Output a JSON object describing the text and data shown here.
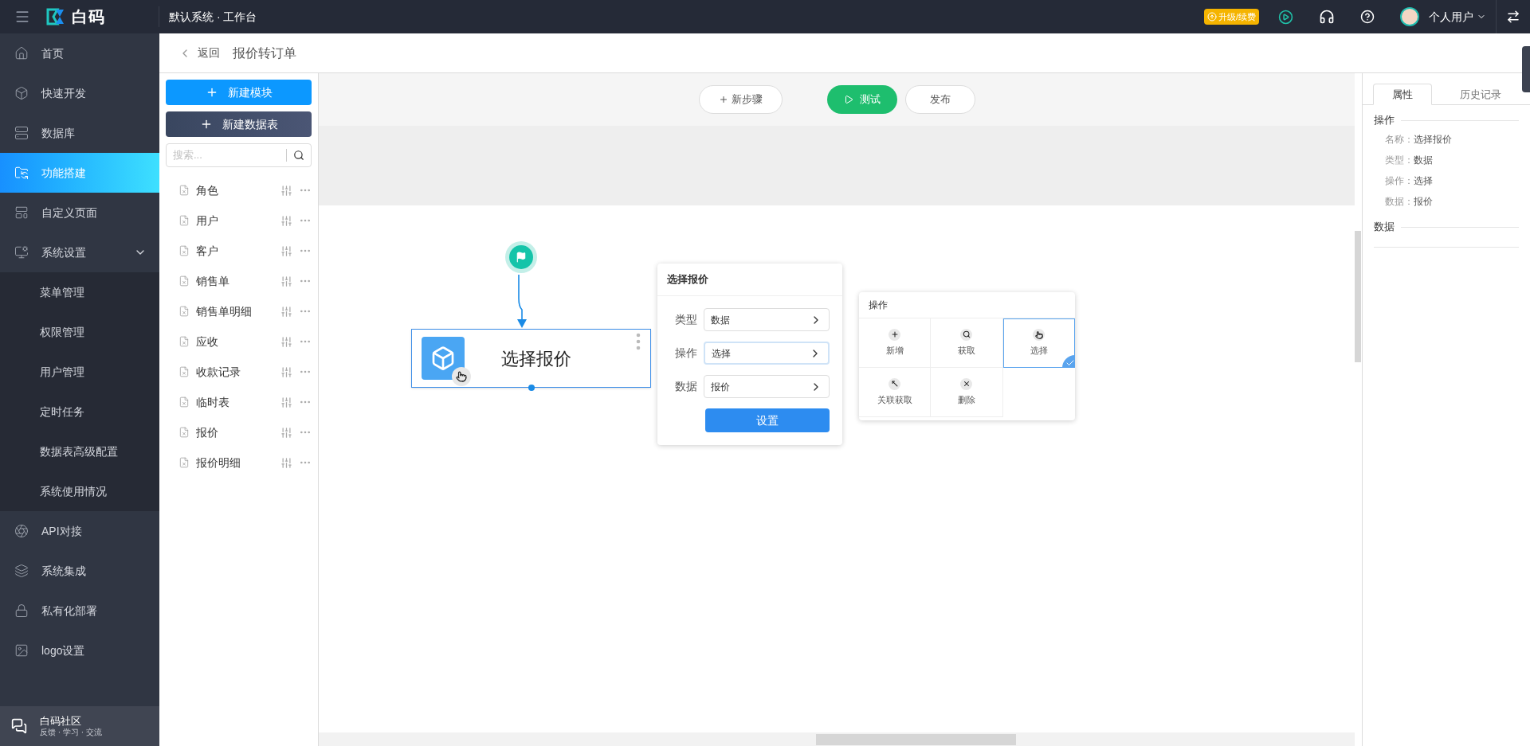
{
  "topbar": {
    "logo_text": "白码",
    "workspace": "默认系统 · 工作台",
    "upgrade": "升级/续费",
    "user": "个人用户"
  },
  "sidebar": {
    "items": [
      {
        "label": "首页",
        "selected": false
      },
      {
        "label": "快速开发",
        "selected": false
      },
      {
        "label": "数据库",
        "selected": false
      },
      {
        "label": "功能搭建",
        "selected": true
      },
      {
        "label": "自定义页面",
        "selected": false
      },
      {
        "label": "系统设置",
        "selected": false,
        "expanded": true,
        "children": [
          {
            "label": "菜单管理"
          },
          {
            "label": "权限管理"
          },
          {
            "label": "用户管理"
          },
          {
            "label": "定时任务"
          },
          {
            "label": "数据表高级配置"
          },
          {
            "label": "系统使用情况"
          }
        ]
      },
      {
        "label": "API对接",
        "selected": false
      },
      {
        "label": "系统集成",
        "selected": false
      },
      {
        "label": "私有化部署",
        "selected": false
      },
      {
        "label": "logo设置",
        "selected": false
      }
    ],
    "community": {
      "title": "白码社区",
      "subtitle": "反馈 · 学习 · 交流"
    }
  },
  "header": {
    "back": "返回",
    "title": "报价转订单"
  },
  "modules": {
    "buttons": [
      {
        "label": "新建模块",
        "kind": "primary"
      },
      {
        "label": "新建数据表",
        "kind": "dark"
      }
    ],
    "search": {
      "placeholder": "搜索..."
    },
    "tables": [
      {
        "name": "角色"
      },
      {
        "name": "用户"
      },
      {
        "name": "客户"
      },
      {
        "name": "销售单"
      },
      {
        "name": "销售单明细"
      },
      {
        "name": "应收"
      },
      {
        "name": "收款记录"
      },
      {
        "name": "临时表"
      },
      {
        "name": "报价"
      },
      {
        "name": "报价明细"
      }
    ]
  },
  "toolbar": {
    "new_step": "新步骤",
    "test": "测试",
    "publish": "发布"
  },
  "canvas": {
    "node": {
      "title": "选择报价",
      "selected": true
    },
    "config": {
      "title": "选择报价",
      "fields": [
        {
          "label": "类型",
          "value": "数据",
          "focused": false
        },
        {
          "label": "操作",
          "value": "选择",
          "focused": true
        },
        {
          "label": "数据",
          "value": "报价",
          "focused": false
        }
      ],
      "button": "设置"
    },
    "operations": {
      "title": "操作",
      "options": [
        {
          "label": "新增",
          "selected": false
        },
        {
          "label": "获取",
          "selected": false
        },
        {
          "label": "选择",
          "selected": true
        },
        {
          "label": "关联获取",
          "selected": false
        },
        {
          "label": "删除",
          "selected": false
        }
      ]
    }
  },
  "properties": {
    "tabs": [
      {
        "label": "属性",
        "selected": true
      },
      {
        "label": "历史记录",
        "selected": false
      }
    ],
    "sections": [
      {
        "title": "操作",
        "rows": [
          {
            "label": "名称：",
            "value": "选择报价"
          },
          {
            "label": "类型：",
            "value": "数据"
          },
          {
            "label": "操作：",
            "value": "选择"
          },
          {
            "label": "数据：",
            "value": "报价"
          }
        ]
      },
      {
        "title": "数据"
      }
    ]
  }
}
